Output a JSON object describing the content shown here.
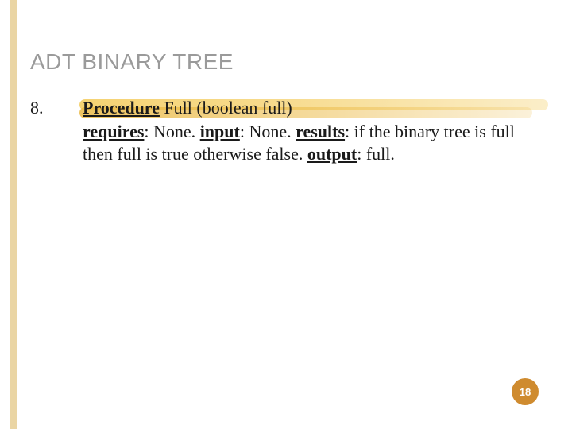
{
  "title": "ADT BINARY TREE",
  "item": {
    "number": "8.",
    "proc_word": "Procedure",
    "proc_rest": " Full (boolean full)",
    "body_prefix": "",
    "kw_requires": "requires",
    "requires_val": ": None. ",
    "kw_input": "input",
    "input_val": ": None. ",
    "kw_results": "results",
    "results_val": ": if the binary tree is full then full is true otherwise false. ",
    "kw_output": "output",
    "output_val": ": full."
  },
  "page_number": "18"
}
